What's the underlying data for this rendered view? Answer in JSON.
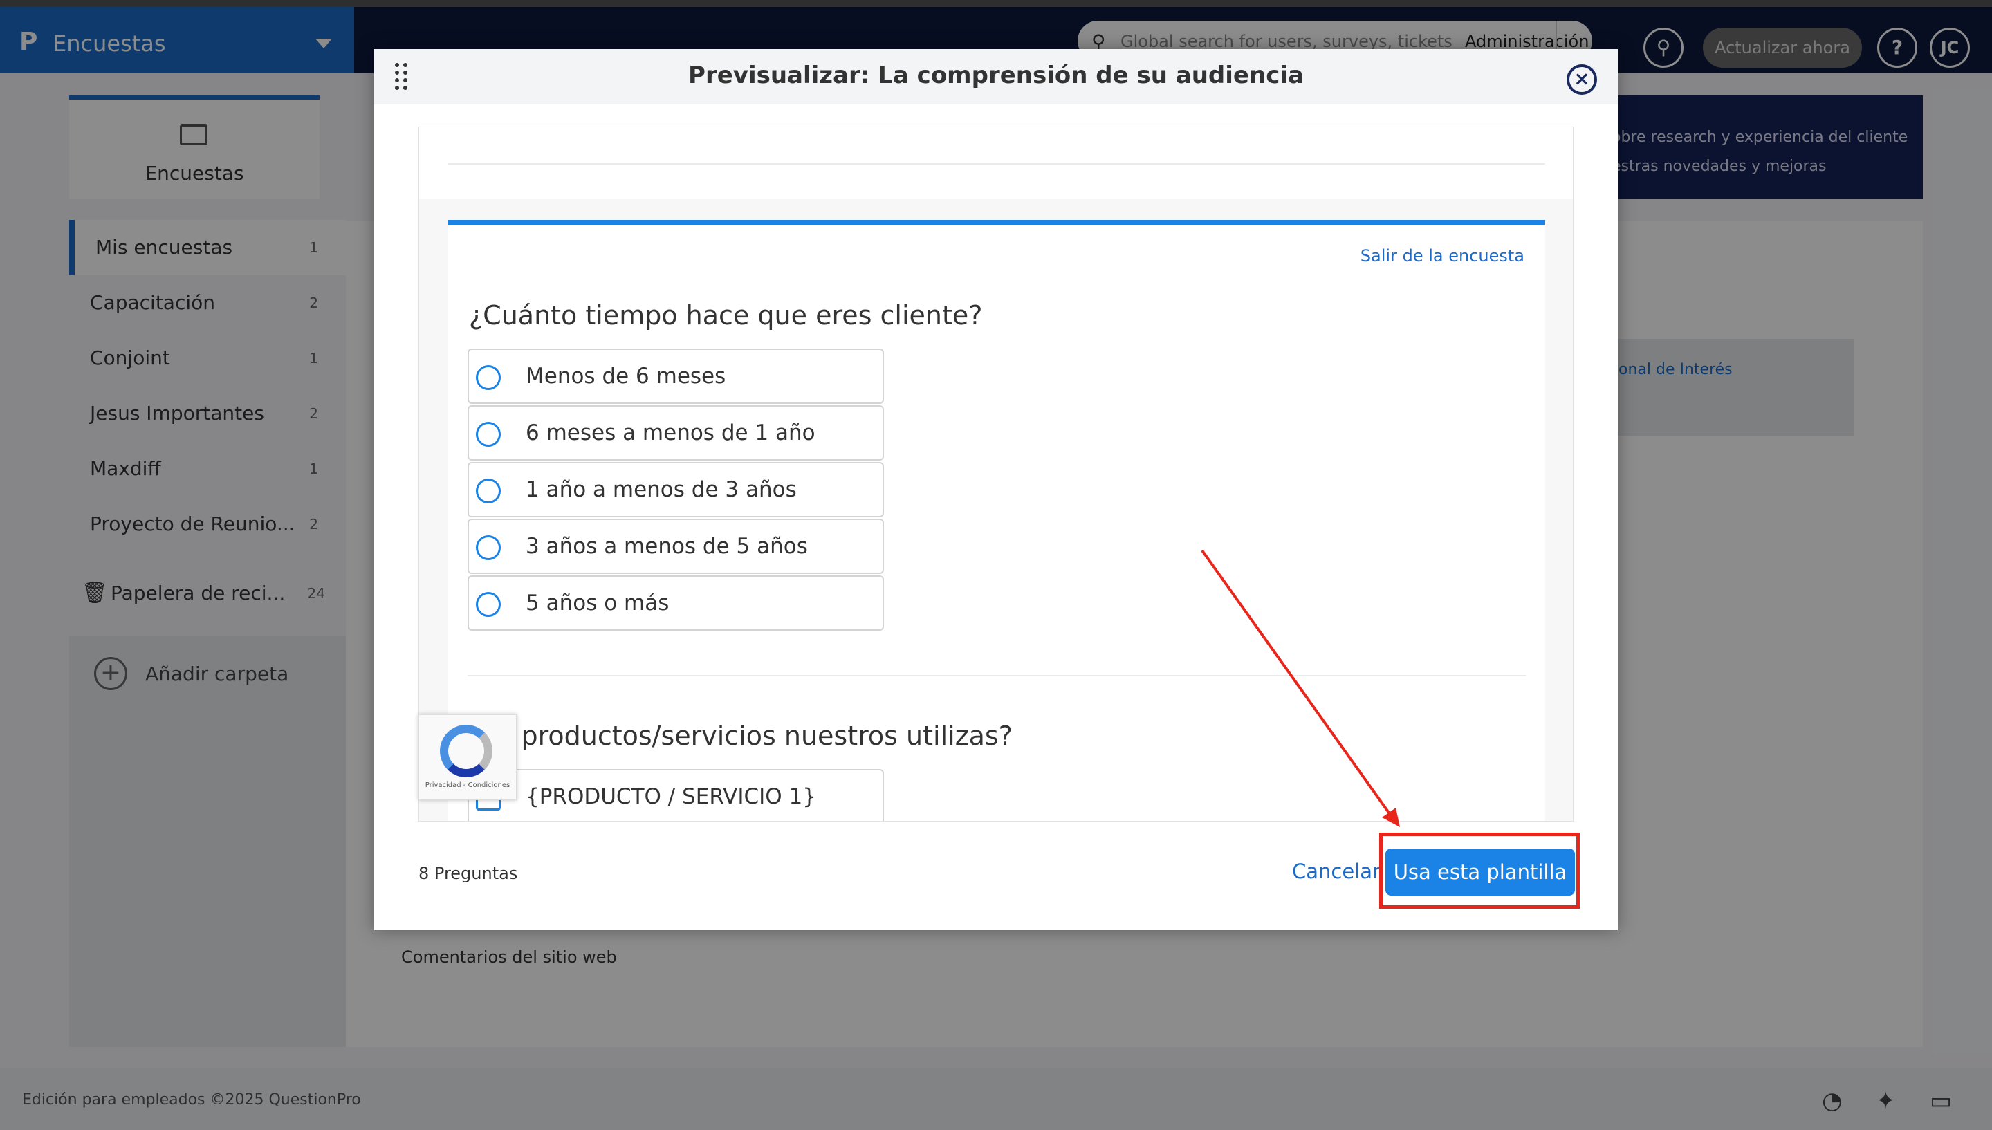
{
  "app": {
    "logo": "P",
    "name": "Encuestas"
  },
  "topbar": {
    "search_placeholder": "Global search for users, surveys, tickets",
    "admin_label": "Administración",
    "update_label": "Actualizar ahora",
    "help_label": "?",
    "avatar_initials": "JC"
  },
  "sidebar": {
    "card_label": "Encuestas",
    "folders": [
      {
        "label": "Mis encuestas",
        "count": "1"
      },
      {
        "label": "Capacitación",
        "count": "2"
      },
      {
        "label": "Conjoint",
        "count": "1"
      },
      {
        "label": "Jesus Importantes",
        "count": "2"
      },
      {
        "label": "Maxdiff",
        "count": "1"
      },
      {
        "label": "Proyecto de Reunio...",
        "count": "2"
      }
    ],
    "trash_label": "Papelera de reci...",
    "trash_count": "24",
    "add_folder_label": "Añadir carpeta"
  },
  "background": {
    "banner_line1": "obre research y experiencia del cliente",
    "banner_line2": "estras novedades y mejoras",
    "card_text": "onal de Interés",
    "web_comments": "Comentarios del sitio web"
  },
  "footer": {
    "copyright": "Edición para empleados ©2025 QuestionPro"
  },
  "modal": {
    "title": "Previsualizar: La comprensión de su audiencia",
    "exit_link": "Salir de la encuesta",
    "questions": [
      {
        "title": "¿Cuánto tiempo hace que eres cliente?",
        "options": [
          "Menos de 6 meses",
          "6 meses a menos de 1 año",
          "1 año a menos de 3 años",
          "3 años a menos de 5 años",
          "5 años o más"
        ]
      },
      {
        "title": "é productos/servicios nuestros utilizas?",
        "options": [
          "{PRODUCTO / SERVICIO 1}"
        ]
      }
    ],
    "recaptcha_legal": "Privacidad - Condiciones",
    "question_count": "8 Preguntas",
    "cancel_label": "Cancelar",
    "use_template_label": "Usa esta plantilla"
  },
  "colors": {
    "brand_blue": "#1b6ac9",
    "primary_button": "#1b82e6",
    "navy": "#0d1b3e",
    "annotation_red": "#e8261c"
  }
}
